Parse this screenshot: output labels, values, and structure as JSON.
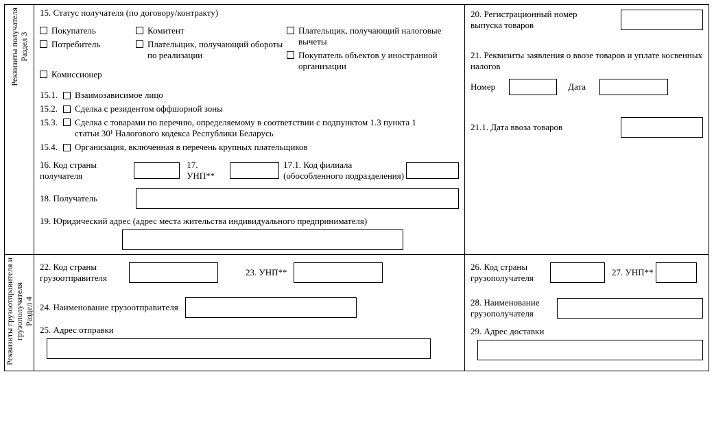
{
  "sectionLabels": {
    "s3_line1": "Реквизиты получателя",
    "s3_line2": "Раздел 3",
    "s4_line1": "Реквизиты грузоотправителя и",
    "s4_line2": "грузополучателя",
    "s4_line3": "Раздел 4"
  },
  "s15": {
    "title": "15. Статус получателя (по договору/контракту)",
    "cb": {
      "buyer": "Покупатель",
      "komitent": "Комитент",
      "payer_deduct": "Плательщик, получающий налоговые вычеты",
      "consumer": "Потребитель",
      "payer_turnover": "Плательщик, получающий обороты по реализации",
      "foreign_buyer": "Покупатель объектов у иностранной организации",
      "commissioner": "Комиссионер"
    },
    "sub": {
      "s15_1": "15.1.",
      "s15_1_t": "Взаимозависимое лицо",
      "s15_2": "15.2.",
      "s15_2_t": "Сделка с резидентом оффшорной зоны",
      "s15_3": "15.3.",
      "s15_3_t_a": "Сделка с товарами по перечню, определяемому в соответствии с подпунктом 1.3 пункта 1",
      "s15_3_t_b": "статьи 30¹ Налогового кодекса Республики Беларусь",
      "s15_4": "15.4.",
      "s15_4_t": "Организация, включенная в перечень крупных плательщиков"
    }
  },
  "s16": "16. Код страны получателя",
  "s17": "17. УНП**",
  "s17_1": "17.1. Код филиала (обособленного подразделения)",
  "s18": "18. Получатель",
  "s19": "19. Юридический адрес (адрес места жительства индивидуального предпринимателя)",
  "s20": "20. Регистрационный номер выпуска товаров",
  "s21": "21. Реквизиты заявления о ввозе товаров и уплате косвенных налогов",
  "s21_num": "Номер",
  "s21_date": "Дата",
  "s21_1": "21.1. Дата ввоза товаров",
  "s22": "22. Код страны грузоотправителя",
  "s23": "23. УНП**",
  "s24": "24. Наименование грузоотправителя",
  "s25": "25. Адрес отправки",
  "s26": "26. Код страны грузополучателя",
  "s27": "27. УНП**",
  "s28": "28. Наименование грузополучателя",
  "s29": "29. Адрес доставки"
}
